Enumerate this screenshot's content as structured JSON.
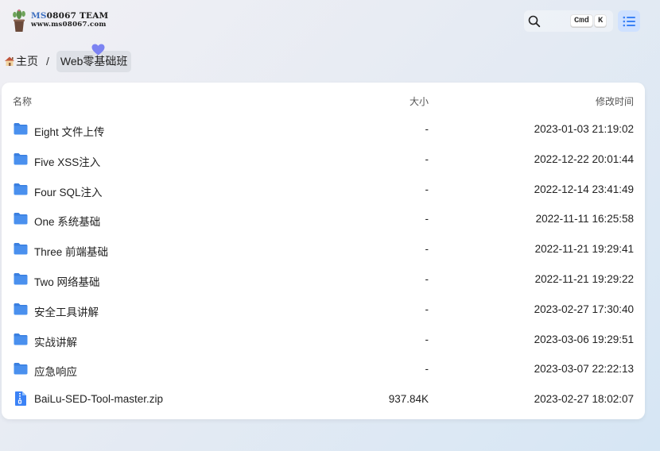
{
  "logo": {
    "title_prefix": "MS",
    "title_rest": "08067 TEAM",
    "url": "www.ms08067.com"
  },
  "search": {
    "key_cmd": "Cmd",
    "key_k": "K"
  },
  "breadcrumb": {
    "home": "主页",
    "separator": "/",
    "current": "Web零基础班"
  },
  "table": {
    "headers": {
      "name": "名称",
      "size": "大小",
      "modified": "修改时间"
    },
    "rows": [
      {
        "name": "Eight 文件上传",
        "size": "-",
        "modified": "2023-01-03 21:19:02",
        "icon": "folder-icon"
      },
      {
        "name": "Five XSS注入",
        "size": "-",
        "modified": "2022-12-22 20:01:44",
        "icon": "folder-icon"
      },
      {
        "name": "Four SQL注入",
        "size": "-",
        "modified": "2022-12-14 23:41:49",
        "icon": "folder-icon"
      },
      {
        "name": "One 系统基础",
        "size": "-",
        "modified": "2022-11-11 16:25:58",
        "icon": "folder-icon"
      },
      {
        "name": "Three 前端基础",
        "size": "-",
        "modified": "2022-11-21 19:29:41",
        "icon": "folder-icon"
      },
      {
        "name": "Two 网络基础",
        "size": "-",
        "modified": "2022-11-21 19:29:22",
        "icon": "folder-icon"
      },
      {
        "name": "安全工具讲解",
        "size": "-",
        "modified": "2023-02-27 17:30:40",
        "icon": "folder-icon"
      },
      {
        "name": "实战讲解",
        "size": "-",
        "modified": "2023-03-06 19:29:51",
        "icon": "folder-icon"
      },
      {
        "name": "应急响应",
        "size": "-",
        "modified": "2023-03-07 22:22:13",
        "icon": "folder-icon"
      },
      {
        "name": "BaiLu-SED-Tool-master.zip",
        "size": "937.84K",
        "modified": "2023-02-27 18:02:07",
        "icon": "zip-file-icon"
      }
    ]
  },
  "colors": {
    "accent": "#3b82f6",
    "folder": "#4a90ee",
    "menu_bg": "#cfe1ff",
    "heart": "#7c83f2"
  }
}
